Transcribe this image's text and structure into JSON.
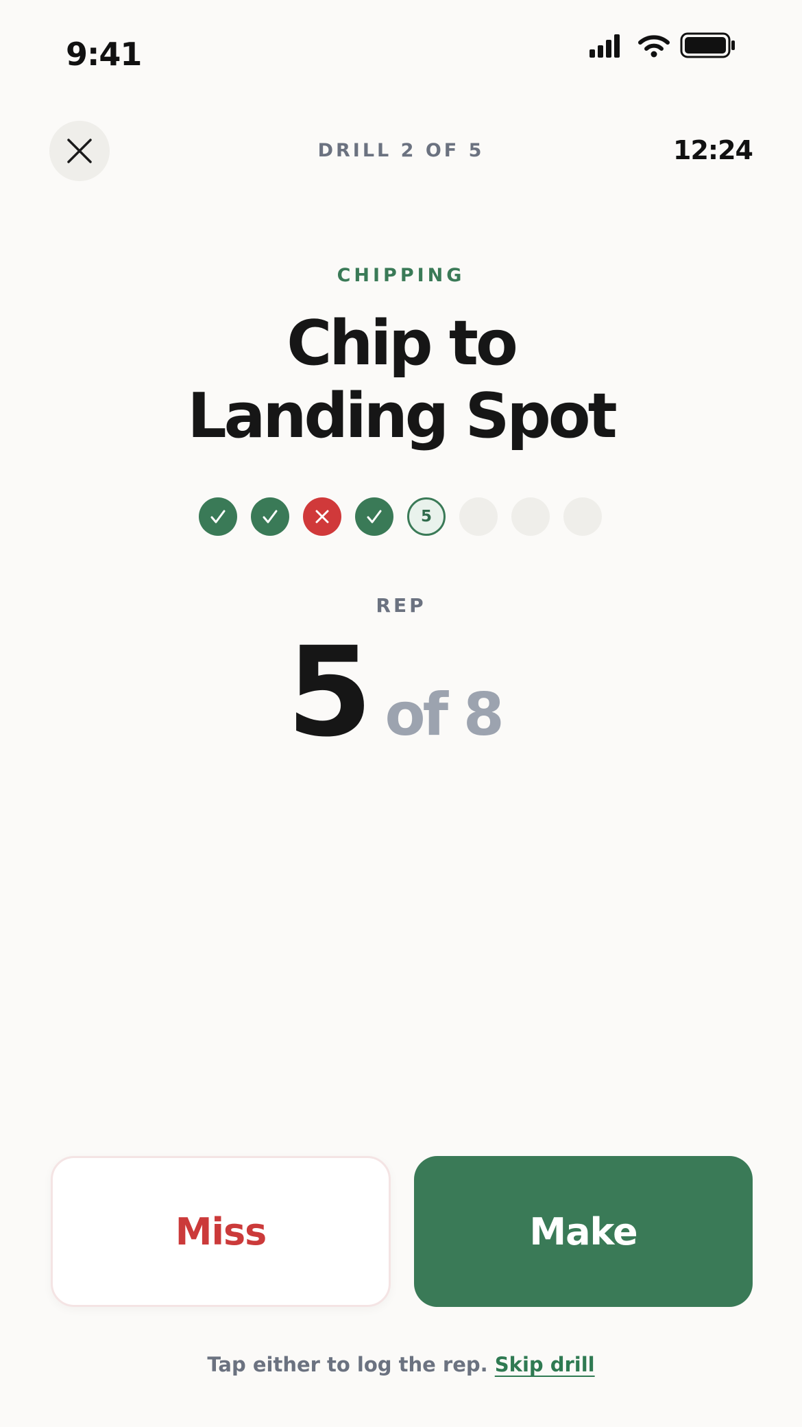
{
  "status_bar": {
    "time": "9:41",
    "icons": [
      "signal-icon",
      "wifi-icon",
      "battery-icon"
    ]
  },
  "header": {
    "close_icon": "close-icon",
    "drill_counter": "DRILL 2 OF 5",
    "timer": "12:24"
  },
  "drill": {
    "category": "CHIPPING",
    "title_line1": "Chip to",
    "title_line2": "Landing Spot"
  },
  "reps": {
    "results": [
      "make",
      "make",
      "miss",
      "make",
      "current",
      "empty",
      "empty",
      "empty"
    ],
    "current_number": "5",
    "label": "REP",
    "current": "5",
    "total_text": "of 8"
  },
  "actions": {
    "miss_label": "Miss",
    "make_label": "Make"
  },
  "footer": {
    "hint": "Tap either to log the rep.",
    "skip_label": "Skip drill"
  },
  "colors": {
    "background": "#FBFAF8",
    "accent_green": "#3A7A57",
    "miss_red": "#D0393A",
    "muted_gray": "#6B7280",
    "light_gray": "#9CA3AF"
  }
}
